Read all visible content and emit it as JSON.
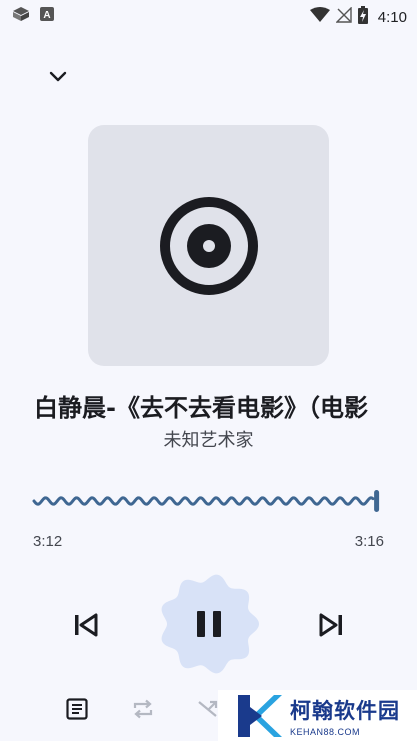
{
  "status_bar": {
    "time": "4:10",
    "icons": [
      "app-cube-icon",
      "a-badge-icon",
      "wifi-icon",
      "no-signal-icon",
      "battery-charging-icon"
    ]
  },
  "header": {
    "collapse_icon": "chevron-down-icon"
  },
  "album_art": {
    "placeholder_icon": "disc-icon",
    "background_color": "#e0e2ea"
  },
  "track": {
    "title": "白静晨-《去不去看电影》（电影",
    "artist": "未知艺术家"
  },
  "progress": {
    "elapsed": "3:12",
    "total": "3:16",
    "fraction": 0.98,
    "accent_color": "#3f6792"
  },
  "controls": {
    "previous_icon": "skip-previous-icon",
    "play_state_icon": "pause-icon",
    "next_icon": "skip-next-icon",
    "play_button_color": "#d8e2f7"
  },
  "bottom_actions": {
    "lyrics_icon": "lyrics-icon",
    "repeat_icon": "repeat-icon",
    "shuffle_icon": "shuffle-icon"
  },
  "watermark": {
    "name": "柯翰软件园",
    "url": "KEHAN88.COM"
  }
}
